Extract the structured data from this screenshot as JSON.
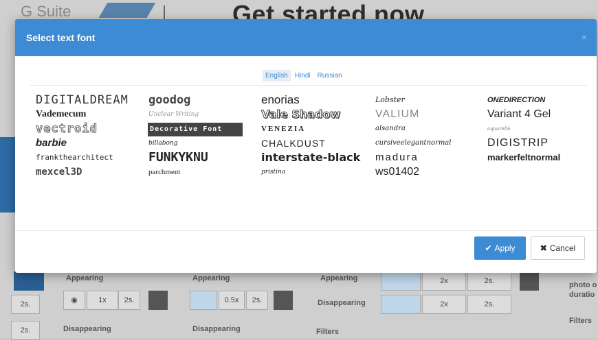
{
  "background": {
    "logo": "G Suite",
    "title": "Get started now",
    "labels": {
      "appearing": "Appearing",
      "disappearing": "Disappearing",
      "filters": "Filters",
      "side_text_1": "photo o",
      "side_text_2": "duratio"
    },
    "values": {
      "v2s": "2s.",
      "v1x": "1x",
      "v05x": "0.5x",
      "v2x": "2x"
    }
  },
  "modal": {
    "title": "Select text font",
    "close": "×",
    "languages": [
      "English",
      "Hindi",
      "Russian"
    ],
    "active_language": "English",
    "fonts": [
      "DIGITALDREAM",
      "goodog",
      "enorias",
      "Lobster",
      "ONEDIRECTION",
      "Vademecum",
      "Unclear Writing",
      "Vale Shadow",
      "VALIUM",
      "Variant 4 Gel",
      "vectroid",
      "Decorative Font",
      "VENEZIA",
      "alsandra",
      "aquarelle",
      "barbie",
      "billabong",
      "CHALKDUST",
      "cursiveelegantnormal",
      "DIGISTRIP",
      "frankthearchitect",
      "FUNKYKNU",
      "interstate-black",
      "madura",
      "markerfeltnormal",
      "mexcel3D",
      "parchment",
      "pristina",
      "ws01402",
      ""
    ],
    "apply_label": "Apply",
    "cancel_label": "Cancel"
  },
  "colors": {
    "header": "#3d8bd4",
    "apply": "#3d8bd4"
  }
}
